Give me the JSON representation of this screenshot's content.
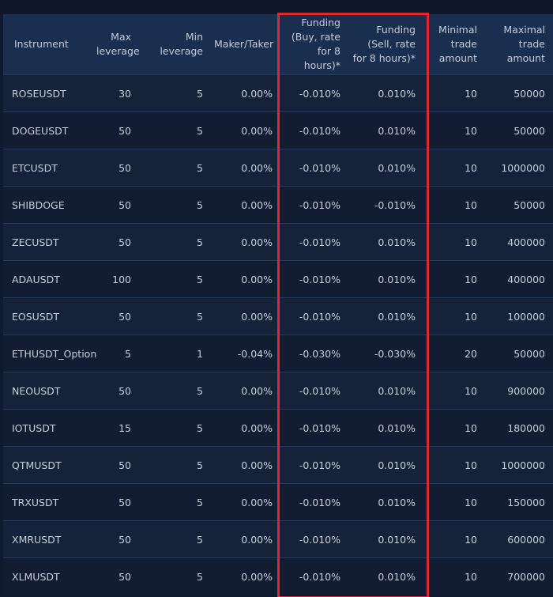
{
  "columns": [
    "Instrument",
    "Max leverage",
    "Min leverage",
    "Maker/Taker",
    "Funding (Buy, rate for 8 hours)*",
    "Funding (Sell, rate for 8 hours)*",
    "Minimal trade amount",
    "Maximal trade amount"
  ],
  "rows": [
    [
      "ROSEUSDT",
      "30",
      "5",
      "0.00%",
      "-0.010%",
      "0.010%",
      "10",
      "50000"
    ],
    [
      "DOGEUSDT",
      "50",
      "5",
      "0.00%",
      "-0.010%",
      "0.010%",
      "10",
      "50000"
    ],
    [
      "ETCUSDT",
      "50",
      "5",
      "0.00%",
      "-0.010%",
      "0.010%",
      "10",
      "1000000"
    ],
    [
      "SHIBDOGE",
      "50",
      "5",
      "0.00%",
      "-0.010%",
      "-0.010%",
      "10",
      "50000"
    ],
    [
      "ZECUSDT",
      "50",
      "5",
      "0.00%",
      "-0.010%",
      "0.010%",
      "10",
      "400000"
    ],
    [
      "ADAUSDT",
      "100",
      "5",
      "0.00%",
      "-0.010%",
      "0.010%",
      "10",
      "400000"
    ],
    [
      "EOSUSDT",
      "50",
      "5",
      "0.00%",
      "-0.010%",
      "0.010%",
      "10",
      "100000"
    ],
    [
      "ETHUSDT_Option",
      "5",
      "1",
      "-0.04%",
      "-0.030%",
      "-0.030%",
      "20",
      "50000"
    ],
    [
      "NEOUSDT",
      "50",
      "5",
      "0.00%",
      "-0.010%",
      "0.010%",
      "10",
      "900000"
    ],
    [
      "IOTUSDT",
      "15",
      "5",
      "0.00%",
      "-0.010%",
      "0.010%",
      "10",
      "180000"
    ],
    [
      "QTMUSDT",
      "50",
      "5",
      "0.00%",
      "-0.010%",
      "0.010%",
      "10",
      "1000000"
    ],
    [
      "TRXUSDT",
      "50",
      "5",
      "0.00%",
      "-0.010%",
      "0.010%",
      "10",
      "150000"
    ],
    [
      "XMRUSDT",
      "50",
      "5",
      "0.00%",
      "-0.010%",
      "0.010%",
      "10",
      "600000"
    ],
    [
      "XLMUSDT",
      "50",
      "5",
      "0.00%",
      "-0.010%",
      "0.010%",
      "10",
      "700000"
    ]
  ],
  "colors": {
    "header_bg": "#1a2e4f",
    "row_odd_bg": "#16223a",
    "row_even_bg": "#121c33",
    "highlight_border": "#e0262e"
  }
}
